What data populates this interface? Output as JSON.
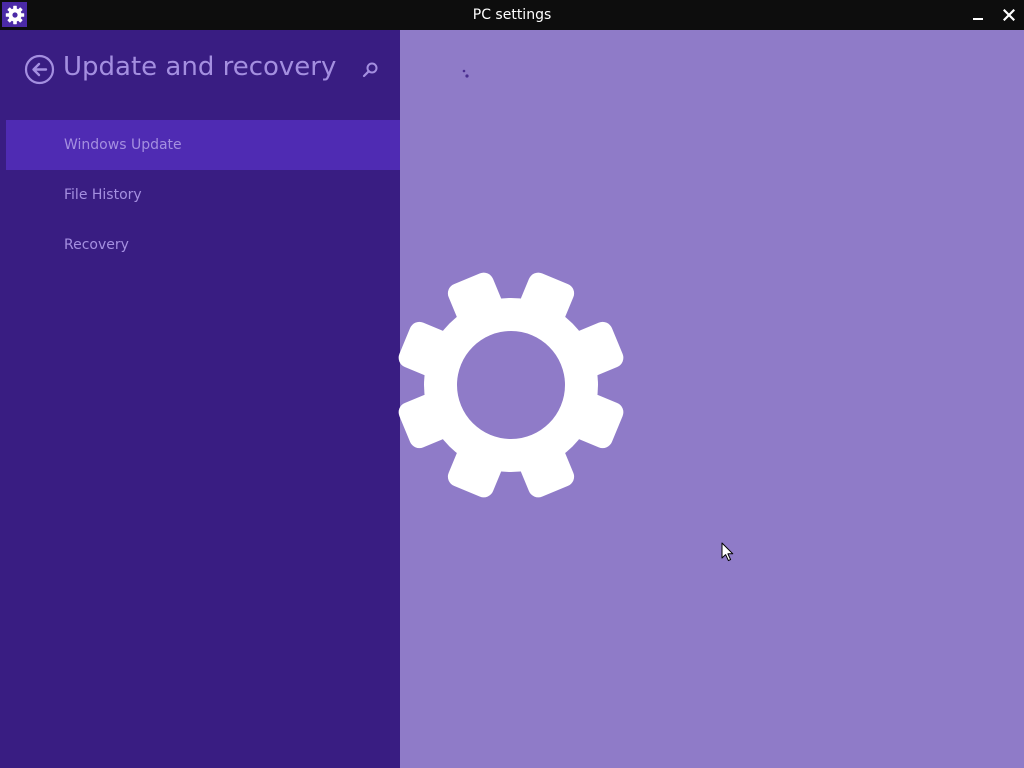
{
  "window": {
    "title": "PC settings",
    "app_icon": "gear-icon",
    "controls": {
      "minimize_icon": "minimize-icon",
      "close_icon": "close-icon"
    }
  },
  "sidebar": {
    "back_icon": "back-arrow-icon",
    "title": "Update and recovery",
    "search_icon": "search-icon",
    "items": [
      {
        "label": "Windows Update",
        "selected": true
      },
      {
        "label": "File History",
        "selected": false
      },
      {
        "label": "Recovery",
        "selected": false
      }
    ]
  },
  "content": {
    "loading_icon": "loading-dots-icon",
    "splash_icon": "gear-icon"
  },
  "colors": {
    "titlebar": "#0d0d0d",
    "sidebar": "#391d82",
    "sidebar_selected": "#4f2bb3",
    "sidebar_text": "#a48fe0",
    "content_background": "#8f7bc8",
    "splash": "#ffffff"
  }
}
